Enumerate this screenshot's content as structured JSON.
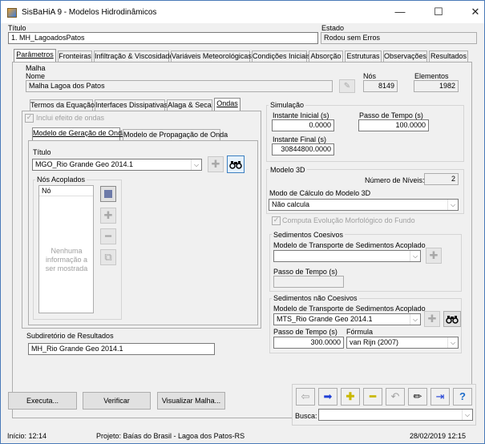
{
  "window": {
    "title": "SisBaHiA 9 - Modelos Hidrodinâmicos",
    "minimize": "—",
    "maximize": "☐",
    "close": "✕"
  },
  "header": {
    "titulo_label": "Título",
    "titulo_value": "1. MH_LagoadosPatos",
    "estado_label": "Estado",
    "estado_value": "Rodou sem Erros"
  },
  "main_tabs": [
    {
      "label": "Parâmetros",
      "active": true
    },
    {
      "label": "Fronteiras",
      "active": false
    },
    {
      "label": "Infiltração & Viscosidade",
      "active": false
    },
    {
      "label": "Variáveis Meteorológicas",
      "active": false
    },
    {
      "label": "Condições Iniciais",
      "active": false
    },
    {
      "label": "Absorção",
      "active": false
    },
    {
      "label": "Estruturas",
      "active": false
    },
    {
      "label": "Observações",
      "active": false
    },
    {
      "label": "Resultados",
      "active": false
    }
  ],
  "malha": {
    "section_label": "Malha",
    "nome_label": "Nome",
    "nome_value": "Malha Lagoa dos Patos",
    "nos_label": "Nós",
    "nos_value": "8149",
    "elementos_label": "Elementos",
    "elementos_value": "1982"
  },
  "sub_tabs": [
    {
      "label": "Termos da Equação",
      "active": false
    },
    {
      "label": "Interfaces Dissipativas",
      "active": false
    },
    {
      "label": "Alaga & Seca",
      "active": false
    },
    {
      "label": "Ondas",
      "active": true
    }
  ],
  "ondas": {
    "inclui_label": "Inclui efeito de ondas",
    "inclui_checked": true,
    "inner_tabs": [
      {
        "label": "Modelo de Geração de Onda",
        "active": true
      },
      {
        "label": "Modelo de Propagação de Onda",
        "active": false
      }
    ],
    "titulo_label": "Título",
    "titulo_value": "MGO_Rio Grande Geo 2014.1",
    "nos_acoplados_label": "Nós Acoplados",
    "list_header": "Nó",
    "empty_message": "Nenhuma informação a ser mostrada"
  },
  "subdiretorio": {
    "label": "Subdiretório de Resultados",
    "value": "MH_Rio Grande Geo 2014.1"
  },
  "simulacao": {
    "title": "Simulação",
    "instante_inicial_label": "Instante Inicial (s)",
    "instante_inicial_value": "0.0000",
    "passo_label": "Passo de Tempo (s)",
    "passo_value": "100.0000",
    "instante_final_label": "Instante Final (s)",
    "instante_final_value": "30844800.0000"
  },
  "modelo3d": {
    "title": "Modelo 3D",
    "niveis_label": "Número de Níveis:",
    "niveis_value": "2",
    "modo_label": "Modo de Cálculo do Modelo 3D",
    "modo_value": "Não calcula",
    "computa_label": "Computa Evolução Morfológico do Fundo",
    "computa_checked": true
  },
  "coesivos": {
    "title": "Sedimentos Coesivos",
    "modelo_label": "Modelo de Transporte de Sedimentos Acoplado",
    "modelo_value": "",
    "passo_label": "Passo de Tempo (s)",
    "passo_value": ""
  },
  "nao_coesivos": {
    "title": "Sedimentos não Coesivos",
    "modelo_label": "Modelo de Transporte de Sedimentos Acoplado",
    "modelo_value": "MTS_Rio Grande Geo 2014.1",
    "passo_label": "Passo de Tempo (s)",
    "passo_value": "300.0000",
    "formula_label": "Fórmula",
    "formula_value": "van Rijn (2007)"
  },
  "buttons": {
    "executa": "Executa...",
    "verificar": "Verificar",
    "visualizar": "Visualizar Malha..."
  },
  "toolbar": {
    "busca_label": "Busca:",
    "busca_value": ""
  },
  "status": {
    "inicio": "Início: 12:14",
    "projeto": "Projeto: Baías do Brasil - Lagoa dos Patos-RS",
    "datetime": "28/02/2019 12:15"
  },
  "colors": {
    "accent_blue": "#1f3fd6",
    "accent_yellow": "#e8d400",
    "help_blue": "#1e6cc9",
    "window_border": "#4a7ab8"
  }
}
